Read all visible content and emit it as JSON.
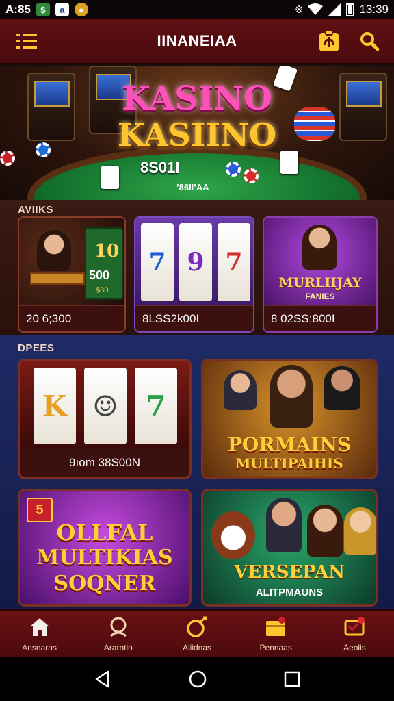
{
  "status_bar": {
    "time": "A:85",
    "clock": "13:39"
  },
  "app_bar": {
    "title": "IINANEIAA"
  },
  "hero": {
    "brand_line1": "KASINO",
    "brand_line2": "KASIINO",
    "amount": "8S01I",
    "small_text": "’86II’AA"
  },
  "section1": {
    "label": "AVIIKS",
    "tiles": [
      {
        "caption": "20 6;300",
        "art_text_1": "10",
        "art_text_2": "500",
        "art_text_3": "$30"
      },
      {
        "caption": "8LSS2k00I",
        "reel_top": [
          "7",
          "9",
          "7"
        ]
      },
      {
        "caption": "8 02SS:800I",
        "art_text": "MURLIIJAY",
        "art_sub": "FANIES"
      }
    ]
  },
  "section2": {
    "label": "DPEES",
    "tiles": [
      {
        "caption": "9ıom 38S00N",
        "reels": [
          "K",
          "☺",
          "7"
        ]
      },
      {
        "art_line1": "PORMAINS",
        "art_line2": "MULTIPAIHIS"
      },
      {
        "art_line1": "OLLFAL",
        "art_line2": "MULTIKIAS",
        "art_line3": "SOQNER",
        "badge": "5"
      },
      {
        "art_line1": "VERSEPAN",
        "art_line2": "ALITPMAUNS"
      }
    ]
  },
  "bottom_nav": [
    {
      "label": "Ansnaras",
      "icon": "home-icon"
    },
    {
      "label": "Ararntio",
      "icon": "search-icon"
    },
    {
      "label": "Aliidnas",
      "icon": "favorite-icon"
    },
    {
      "label": "Pennaas",
      "icon": "wallet-icon"
    },
    {
      "label": "Aeolis",
      "icon": "notifications-icon"
    }
  ],
  "colors": {
    "app_bar": "#5e0f12",
    "accent_gold": "#ffc52e",
    "nav_text": "#f2d6b2",
    "section2_bg": "#1f2b66"
  }
}
